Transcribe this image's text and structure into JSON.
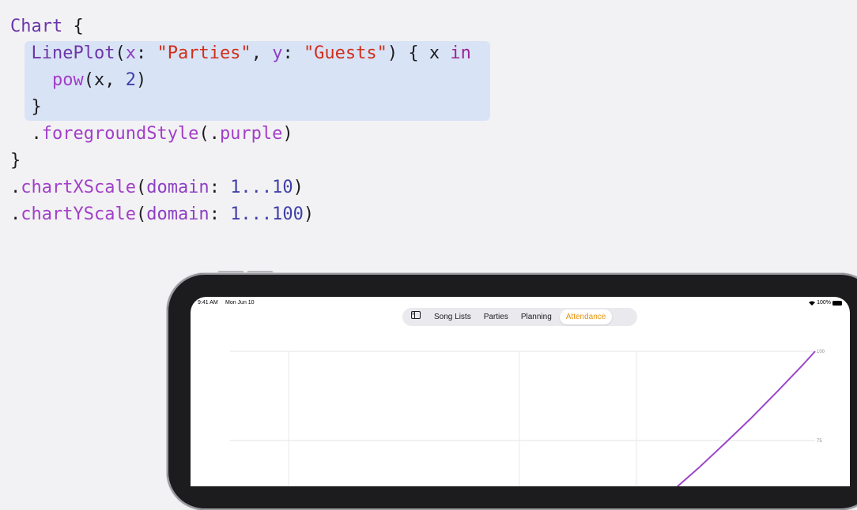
{
  "code": {
    "lines": [
      [
        {
          "t": "Chart",
          "c": "ty"
        },
        {
          "t": " {",
          "c": "pl"
        }
      ],
      [
        {
          "t": "  ",
          "c": "pl"
        },
        {
          "t": "LinePlot",
          "c": "ty"
        },
        {
          "t": "(",
          "c": "pl"
        },
        {
          "t": "x",
          "c": "lbl"
        },
        {
          "t": ": ",
          "c": "pl"
        },
        {
          "t": "\"Parties\"",
          "c": "st"
        },
        {
          "t": ", ",
          "c": "pl"
        },
        {
          "t": "y",
          "c": "lbl"
        },
        {
          "t": ": ",
          "c": "pl"
        },
        {
          "t": "\"Guests\"",
          "c": "st"
        },
        {
          "t": ") { x ",
          "c": "pl"
        },
        {
          "t": "in",
          "c": "kw"
        }
      ],
      [
        {
          "t": "    ",
          "c": "pl"
        },
        {
          "t": "pow",
          "c": "fn"
        },
        {
          "t": "(x, ",
          "c": "pl"
        },
        {
          "t": "2",
          "c": "num"
        },
        {
          "t": ")",
          "c": "pl"
        }
      ],
      [
        {
          "t": "  }",
          "c": "pl"
        }
      ],
      [
        {
          "t": "  .",
          "c": "pl"
        },
        {
          "t": "foregroundStyle",
          "c": "fn"
        },
        {
          "t": "(.",
          "c": "pl"
        },
        {
          "t": "purple",
          "c": "fn"
        },
        {
          "t": ")",
          "c": "pl"
        }
      ],
      [
        {
          "t": "}",
          "c": "pl"
        }
      ],
      [
        {
          "t": ".",
          "c": "pl"
        },
        {
          "t": "chartXScale",
          "c": "fn"
        },
        {
          "t": "(",
          "c": "pl"
        },
        {
          "t": "domain",
          "c": "lbl"
        },
        {
          "t": ": ",
          "c": "pl"
        },
        {
          "t": "1...10",
          "c": "num"
        },
        {
          "t": ")",
          "c": "pl"
        }
      ],
      [
        {
          "t": ".",
          "c": "pl"
        },
        {
          "t": "chartYScale",
          "c": "fn"
        },
        {
          "t": "(",
          "c": "pl"
        },
        {
          "t": "domain",
          "c": "lbl"
        },
        {
          "t": ": ",
          "c": "pl"
        },
        {
          "t": "1...100",
          "c": "num"
        },
        {
          "t": ")",
          "c": "pl"
        }
      ]
    ]
  },
  "status_bar": {
    "time": "9:41 AM",
    "date": "Mon Jun 10",
    "battery": "100%"
  },
  "tabs": {
    "items": [
      {
        "label": "Song Lists",
        "active": false
      },
      {
        "label": "Parties",
        "active": false
      },
      {
        "label": "Planning",
        "active": false
      },
      {
        "label": "Attendance",
        "active": true
      }
    ],
    "sidebar_icon": "sidebar-toggle-icon",
    "active_color": "#e8920c"
  },
  "chart_data": {
    "type": "line",
    "series": [
      {
        "color": "#9b45c9",
        "x": [
          7.8,
          8.2,
          8.6,
          9.0,
          9.4,
          9.8,
          10.0
        ],
        "y": [
          60.8,
          67.2,
          74.0,
          81.0,
          88.4,
          96.0,
          100.0
        ]
      }
    ],
    "ytick_labels": [
      "100",
      "75"
    ],
    "y_ticks": [
      100,
      75
    ],
    "xlim": [
      1,
      10
    ],
    "ylim": [
      1,
      100
    ],
    "grid": true
  },
  "colors": {
    "background": "#f2f2f4",
    "code_highlight": "#d9e3f6",
    "line": "#9b45c9"
  }
}
